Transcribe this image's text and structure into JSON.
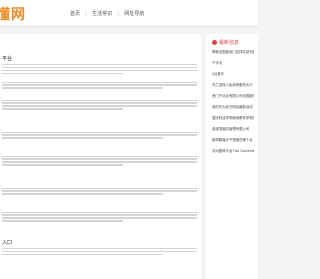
{
  "header": {
    "logo": "懂网",
    "nav": [
      "首页",
      "生活常识",
      "网址导航"
    ]
  },
  "main": {
    "sections": [
      {
        "title": "平台"
      },
      {
        "title": ""
      },
      {
        "title": ""
      },
      {
        "title": ""
      },
      {
        "title": ""
      },
      {
        "title": ""
      },
      {
        "title": ""
      },
      {
        "title": "入口"
      }
    ]
  },
  "sidebar": {
    "title": "最新信息",
    "items": [
      "揭秘全国各地门店排名前列的实体店",
      "千字诀",
      "QQ音乐",
      "乌兰浩特人民政府服务大厅",
      "西门子北京有限公司全国服务网点",
      "我的华为官方网站最新活动",
      "重庆科技学院继续教育学院网",
      "金域湾酒店管理有限公司",
      "新闻联播天气预报在哪个台",
      "苏州园林平台 Fan Convention Ce"
    ]
  }
}
